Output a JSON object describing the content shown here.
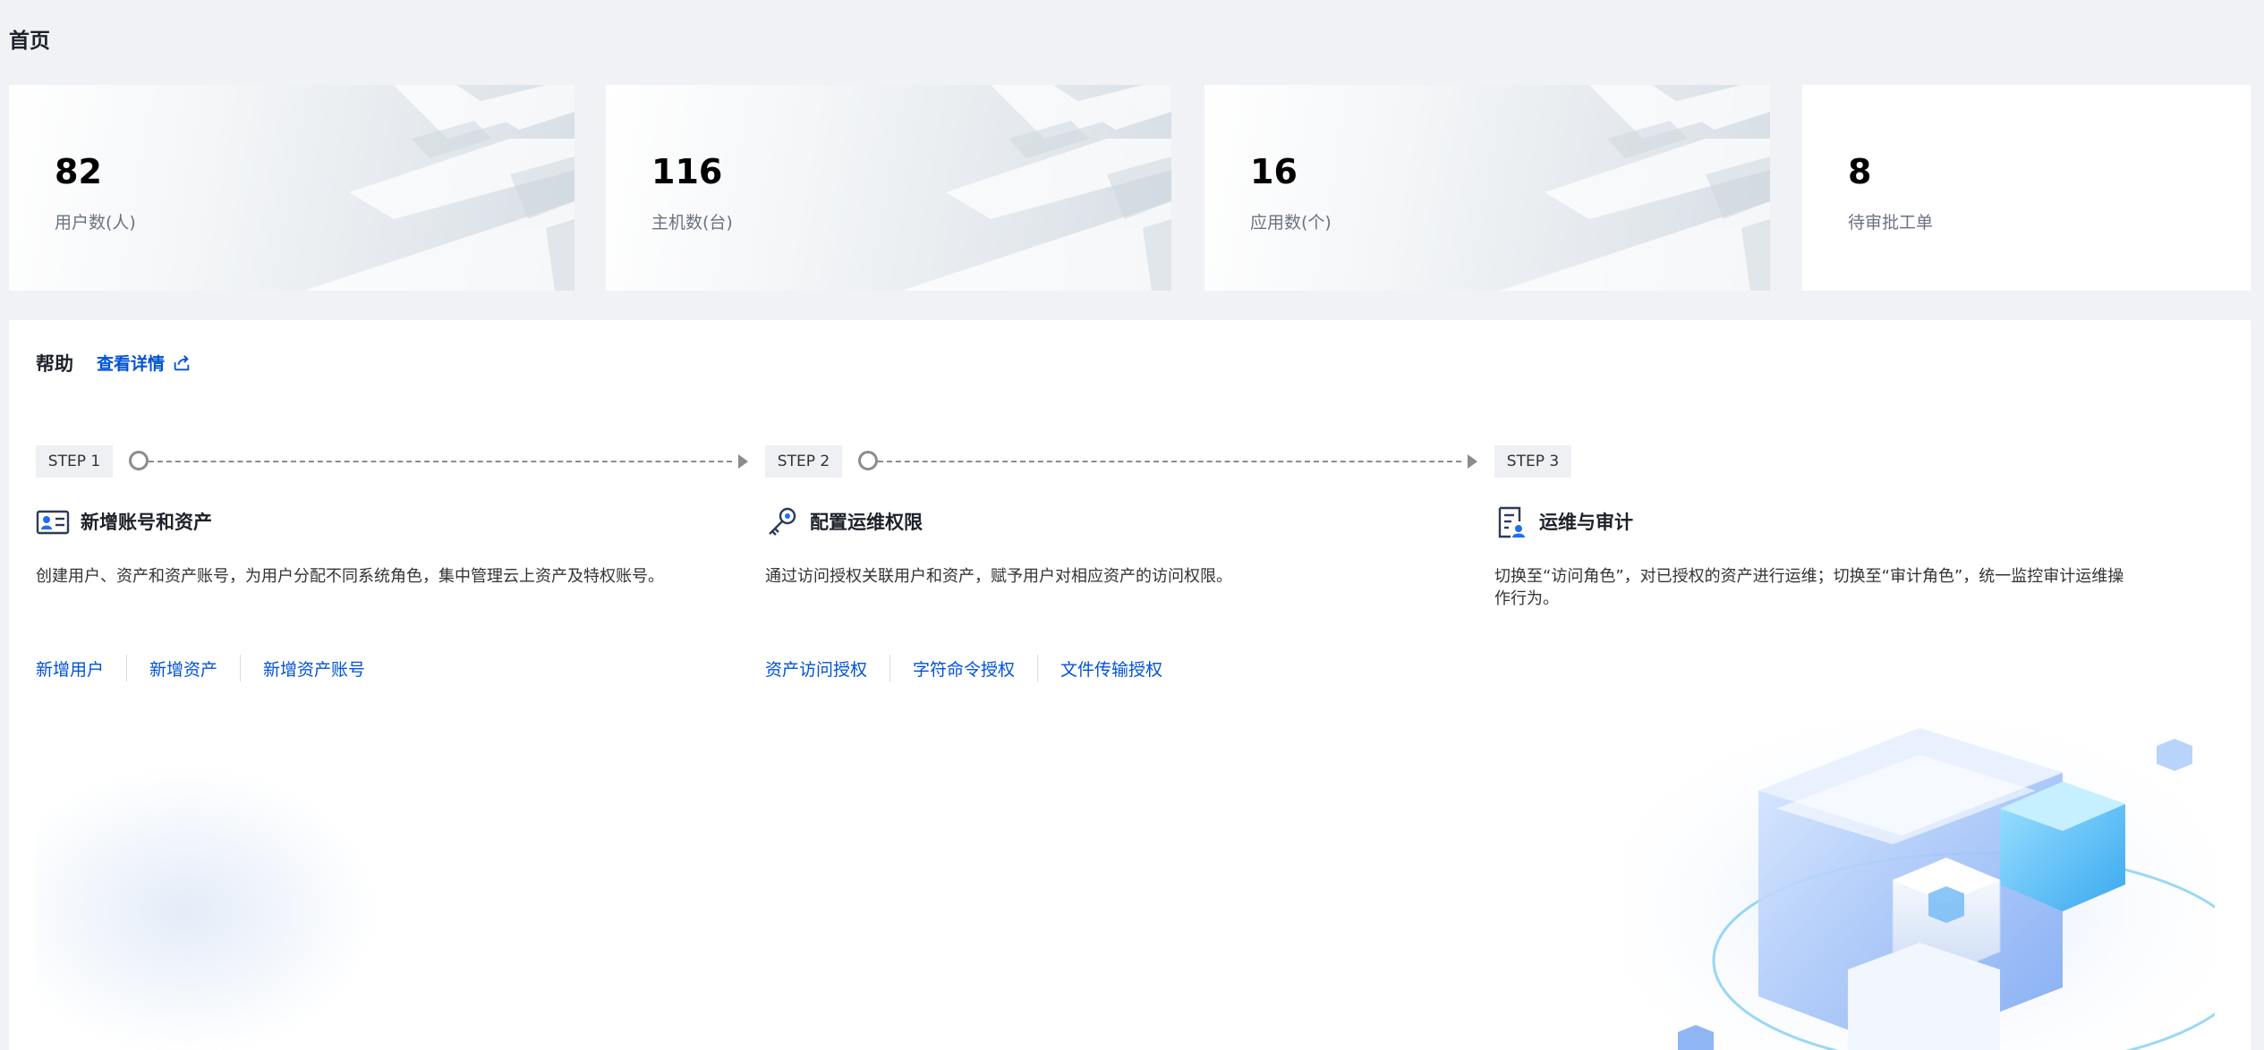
{
  "page": {
    "title": "首页"
  },
  "stats": [
    {
      "value": "82",
      "label": "用户数(人)"
    },
    {
      "value": "116",
      "label": "主机数(台)"
    },
    {
      "value": "16",
      "label": "应用数(个)"
    },
    {
      "value": "8",
      "label": "待审批工单"
    }
  ],
  "help": {
    "title": "帮助",
    "detail_link": "查看详情",
    "steps": [
      {
        "tag": "STEP 1",
        "icon": "account-card-icon",
        "heading": "新增账号和资产",
        "desc": "创建用户、资产和资产账号，为用户分配不同系统角色，集中管理云上资产及特权账号。",
        "links": [
          "新增用户",
          "新增资产",
          "新增资产账号"
        ]
      },
      {
        "tag": "STEP 2",
        "icon": "key-icon",
        "heading": "配置运维权限",
        "desc": "通过访问授权关联用户和资产，赋予用户对相应资产的访问权限。",
        "links": [
          "资产访问授权",
          "字符命令授权",
          "文件传输授权"
        ]
      },
      {
        "tag": "STEP 3",
        "icon": "audit-document-icon",
        "heading": "运维与审计",
        "desc": "切换至“访问角色”，对已授权的资产进行运维；切换至“审计角色”，统一监控审计运维操作行为。",
        "links": []
      }
    ]
  },
  "colors": {
    "accent": "#0052d9",
    "background": "#f0f2f5",
    "card": "#ffffff"
  }
}
